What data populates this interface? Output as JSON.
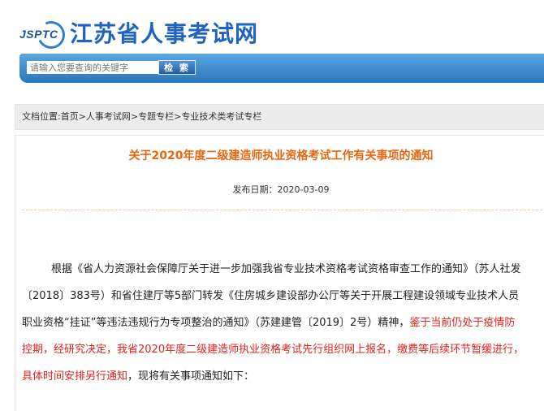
{
  "header": {
    "logo_abbr": "JSPTC",
    "site_title": "江苏省人事考试网"
  },
  "search": {
    "placeholder": "请输入您要查询的关键字",
    "button_label": "检 索"
  },
  "breadcrumb": {
    "prefix": "文档位置:",
    "items": [
      "首页",
      "人事考试网",
      "专题专栏",
      "专业技术类考试专栏"
    ],
    "separator": ">"
  },
  "article": {
    "title": "关于2020年度二级建造师执业资格考试工作有关事项的通知",
    "pubdate": "发布日期：2020-03-09",
    "para1_normal": "根据《省人力资源社会保障厅关于进一步加强我省专业技术资格考试资格审查工作的通知》（苏人社发〔2018〕383号）和省住建厅等5部门转发《住房城乡建设部办公厅等关于开展工程建设领域专业技术人员职业资格“挂证”等违法违规行为专项整治的通知》（苏建建管〔2019〕2号）精神，",
    "para1_red": "鉴于当前仍处于疫情防控期，经研究决定，我省2020年度二级建造师执业资格考试先行组织网上报名，缴费等后续环节暂缓进行，具体时间安排另行通知",
    "para1_tail": "，现将有关事项通知如下："
  },
  "colors": {
    "title_orange": "#e8660f",
    "highlight_red": "#e0221c",
    "site_blue": "#1e63c4",
    "search_bar_blue": "#2f85c9"
  }
}
